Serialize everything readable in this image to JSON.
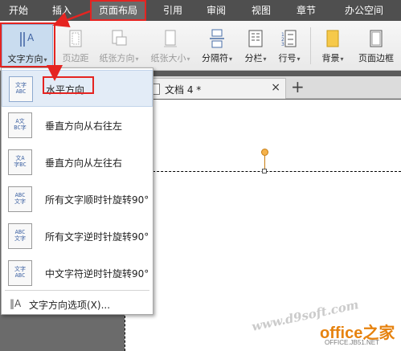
{
  "menu": {
    "tabs": [
      {
        "label": "开始"
      },
      {
        "label": "插入"
      },
      {
        "label": "页面布局"
      },
      {
        "label": "引用"
      },
      {
        "label": "审阅"
      },
      {
        "label": "视图"
      },
      {
        "label": "章节"
      },
      {
        "label": "办公空间"
      }
    ],
    "active_tab": "页面布局"
  },
  "ribbon": {
    "text_direction": {
      "label": "文字方向",
      "icon": "text-direction-icon"
    },
    "page_margin": {
      "label": "页边距",
      "icon": "page-margin-icon",
      "disabled": true
    },
    "paper_orientation": {
      "label": "纸张方向",
      "icon": "paper-orientation-icon",
      "disabled": true
    },
    "paper_size": {
      "label": "纸张大小",
      "icon": "paper-size-icon",
      "disabled": true
    },
    "separator": {
      "label": "分隔符",
      "icon": "separator-icon"
    },
    "columns": {
      "label": "分栏",
      "icon": "columns-icon"
    },
    "line_number": {
      "label": "行号",
      "icon": "line-number-icon"
    },
    "background": {
      "label": "背景",
      "icon": "background-icon"
    },
    "page_border": {
      "label": "页面边框",
      "icon": "page-border-icon"
    },
    "caret": "▾"
  },
  "document_tab": {
    "title": "文档 4 *",
    "close": "×",
    "add": "+"
  },
  "dropdown": {
    "items": [
      {
        "label": "水平方向",
        "icon_text": "文字\nABC",
        "selected": true
      },
      {
        "label": "垂直方向从右往左",
        "icon_text": "ABC\n文字"
      },
      {
        "label": "垂直方向从左往右",
        "icon_text": "文字\nABC"
      },
      {
        "label": "所有文字顺时针旋转90°",
        "icon_text": "ABC\n文字"
      },
      {
        "label": "所有文字逆时针旋转90°",
        "icon_text": "ABC\n文字"
      },
      {
        "label": "中文字符逆时针旋转90°",
        "icon_text": "文字\nABC"
      }
    ],
    "footer": {
      "label": "文字方向选项(X)...",
      "icon": "options-icon"
    }
  },
  "watermark": {
    "url": "www.d9soft.com",
    "logo": "office之家",
    "sub": "OFFICE.JB51.NET"
  },
  "colors": {
    "highlight_red": "#e52421",
    "handle_orange": "#f5b24a"
  }
}
